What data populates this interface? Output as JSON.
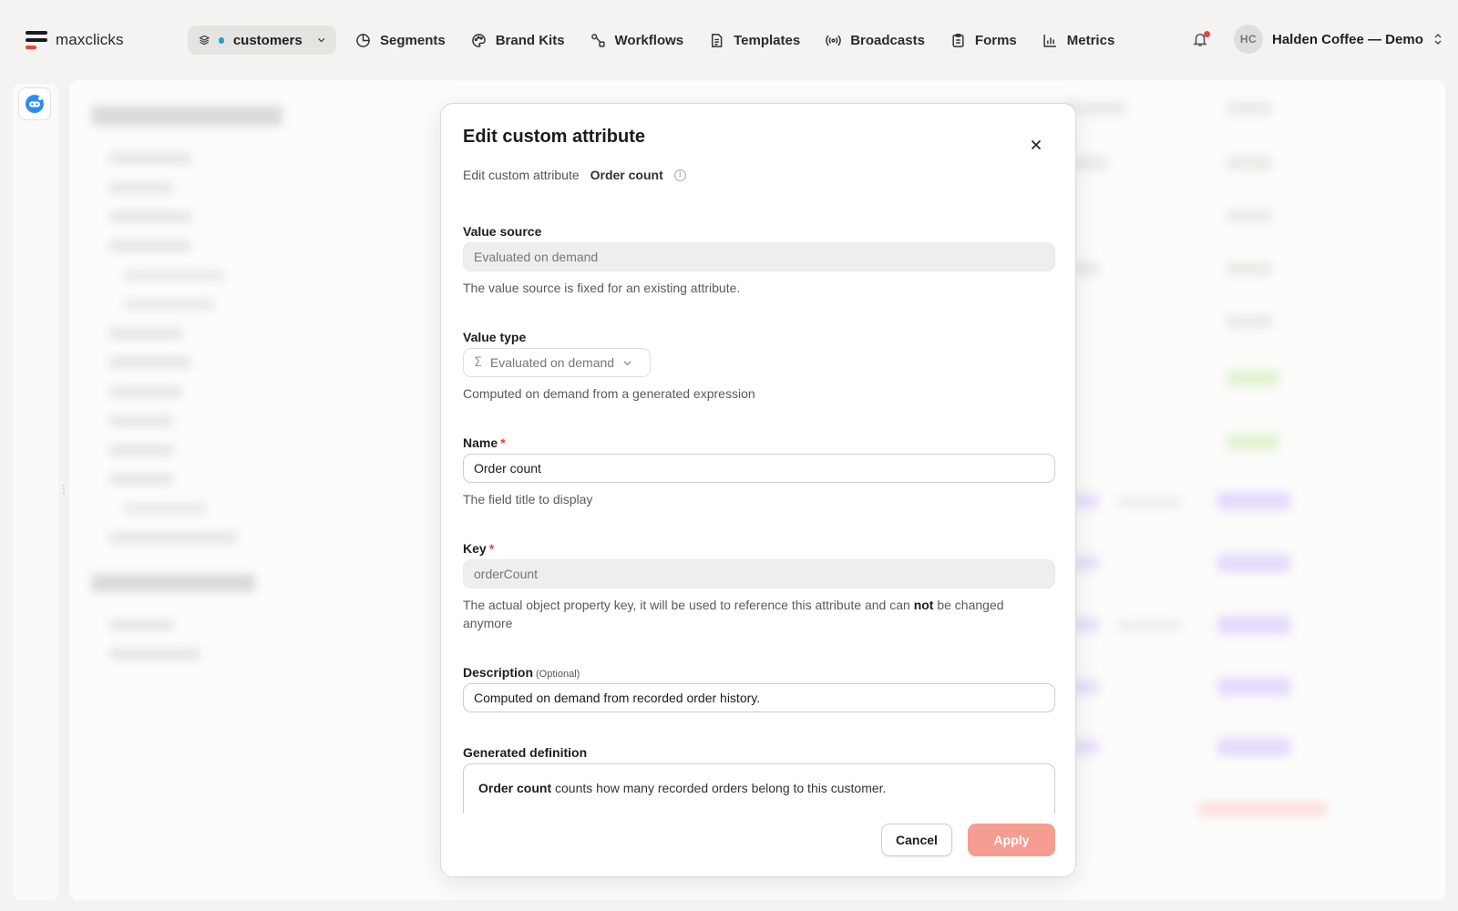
{
  "app": {
    "name": "maxclicks"
  },
  "workspace": {
    "label": "customers",
    "dot_color": "#1aa3d8"
  },
  "nav": {
    "segments": "Segments",
    "brand_kits": "Brand Kits",
    "workflows": "Workflows",
    "templates": "Templates",
    "broadcasts": "Broadcasts",
    "forms": "Forms",
    "metrics": "Metrics"
  },
  "account": {
    "initials": "HC",
    "name": "Halden Coffee — Demo"
  },
  "colors": {
    "accent": "#e8453c",
    "apply_button": "#f59d90"
  },
  "modal": {
    "title": "Edit custom attribute",
    "subtitle_prefix": "Edit custom attribute",
    "subtitle_name": "Order count",
    "value_source": {
      "label": "Value source",
      "value": "Evaluated on demand",
      "hint": "The value source is fixed for an existing attribute."
    },
    "value_type": {
      "label": "Value type",
      "value": "Evaluated on demand",
      "hint": "Computed on demand from a generated expression"
    },
    "name": {
      "label": "Name",
      "required_mark": "*",
      "value": "Order count",
      "hint": "The field title to display"
    },
    "key": {
      "label": "Key",
      "required_mark": "*",
      "value": "orderCount",
      "hint_before": "The actual object property key, it will be used to reference this attribute and can ",
      "hint_bold": "not",
      "hint_after": " be changed anymore"
    },
    "description": {
      "label": "Description",
      "optional": "(Optional)",
      "value": "Computed on demand from recorded order history."
    },
    "generated_definition": {
      "label": "Generated definition",
      "bold": "Order count",
      "text": " counts how many recorded orders belong to this customer."
    },
    "cancel": "Cancel",
    "apply": "Apply"
  }
}
